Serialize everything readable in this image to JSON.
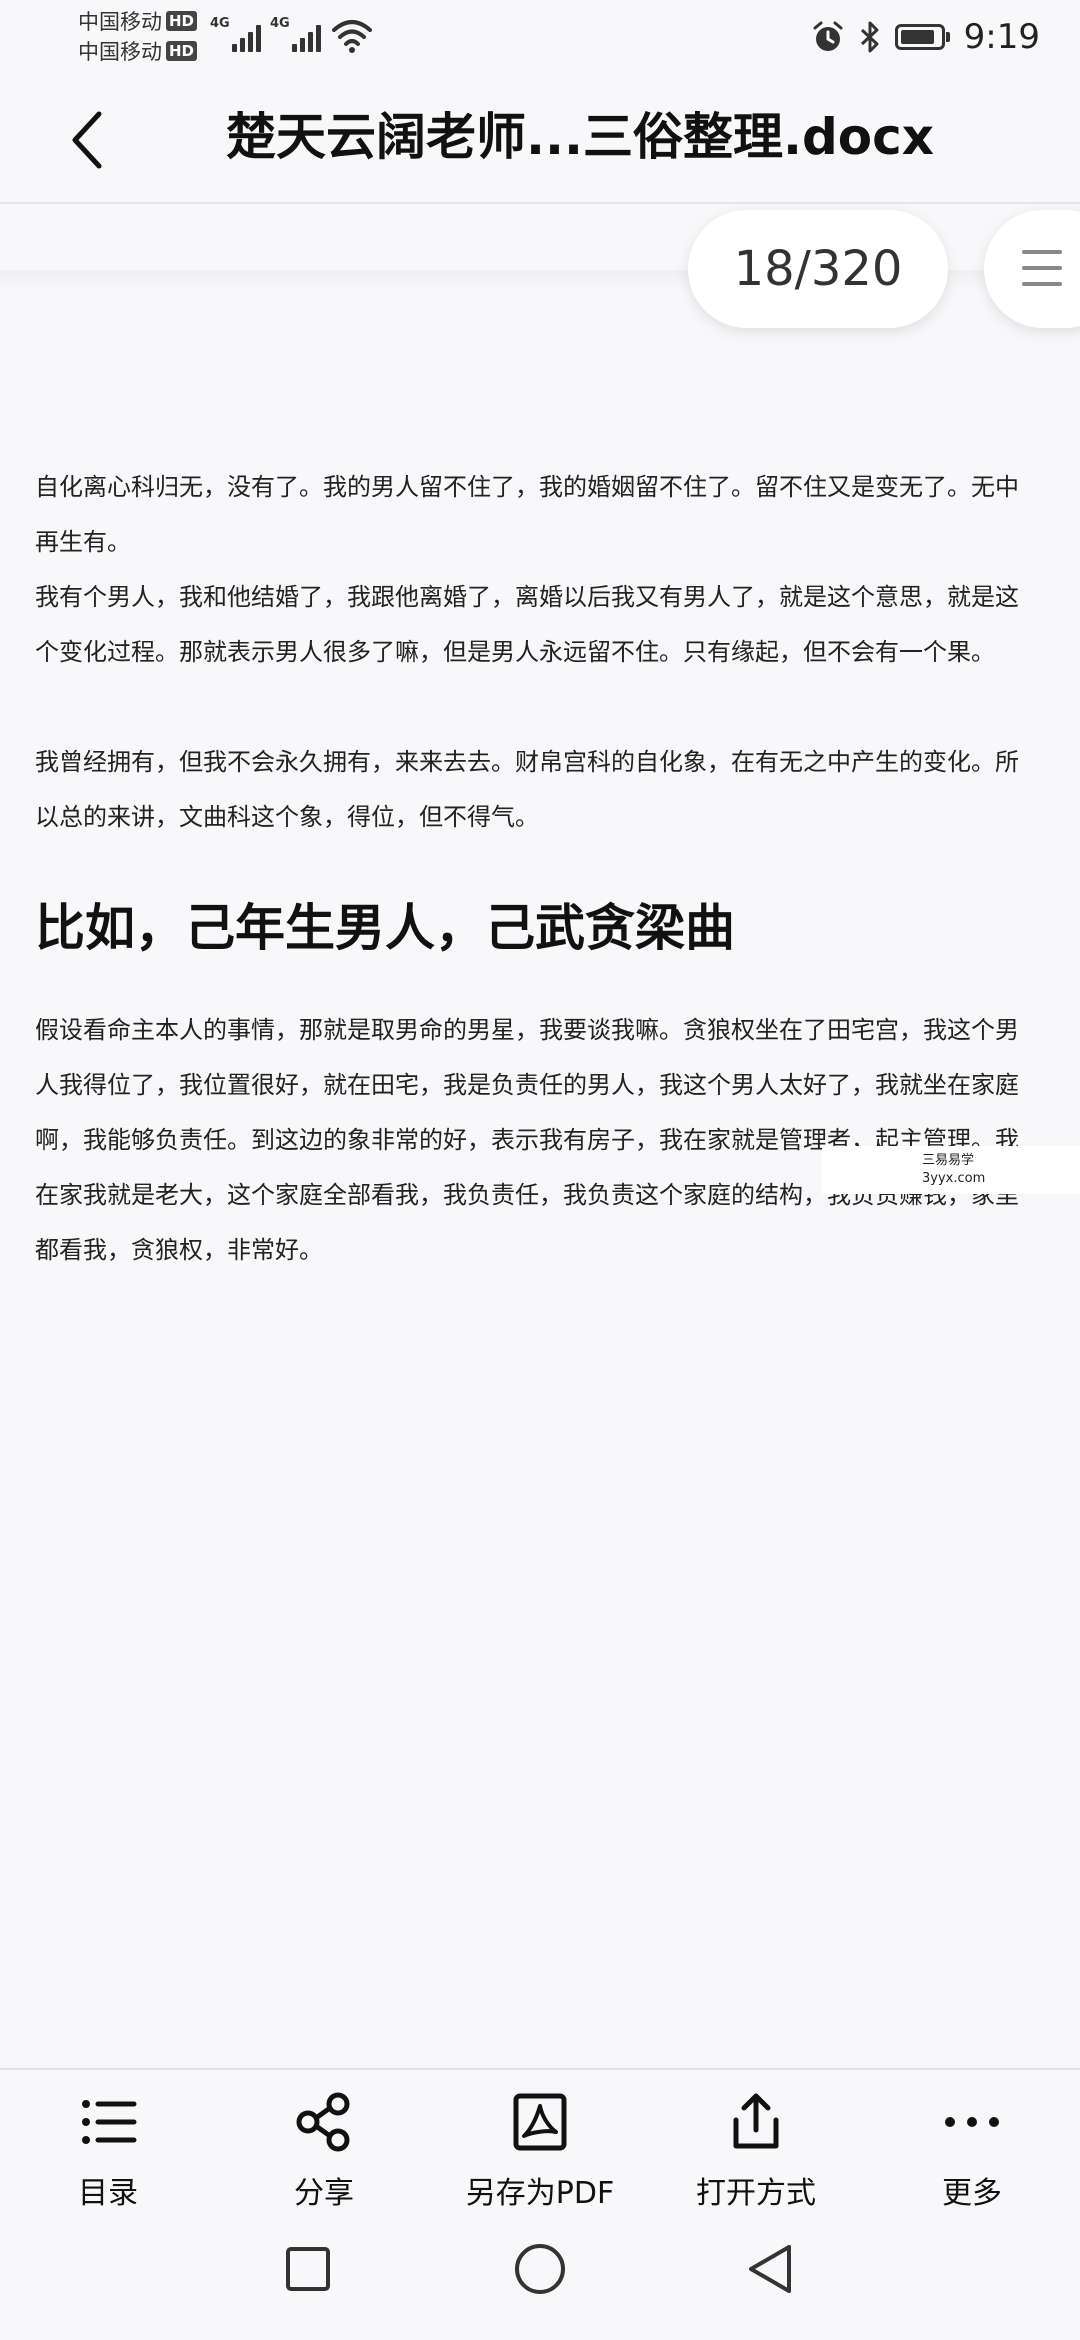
{
  "status_bar": {
    "carrier1": "中国移动",
    "carrier2": "中国移动",
    "hd_badge": "HD",
    "network1": "4G",
    "network2": "4G",
    "time": "9:19"
  },
  "header": {
    "title": "楚天云阔老师...三俗整理.docx"
  },
  "page_indicator": {
    "text": "18/320"
  },
  "document": {
    "para1": "自化离心科归无，没有了。我的男人留不住了，我的婚姻留不住了。留不住又是变无了。无中再生有。",
    "para2": "我有个男人，我和他结婚了，我跟他离婚了，离婚以后我又有男人了，就是这个意思，就是这个变化过程。那就表示男人很多了嘛，但是男人永远留不住。只有缘起，但不会有一个果。",
    "para3": "我曾经拥有，但我不会永久拥有，来来去去。财帛宫科的自化象，在有无之中产生的变化。所以总的来讲，文曲科这个象，得位，但不得气。",
    "heading": "比如，己年生男人，己武贪梁曲",
    "para4": "假设看命主本人的事情，那就是取男命的男星，我要谈我嘛。贪狼权坐在了田宅宫，我这个男人我得位了，我位置很好，就在田宅，我是负责任的男人，我这个男人太好了，我就坐在家庭啊，我能够负责任。到这边的象非常的好，表示我有房子，我在家就是管理者，起主管理。我在家我就是老大，这个家庭全部看我，我负责任，我负责这个家庭的结构，我负责赚钱，家里都看我，贪狼权，非常好。"
  },
  "watermark": {
    "line1": "三易易学",
    "line2": "3yyx.com"
  },
  "toolbar": {
    "items": [
      {
        "label": "目录",
        "icon": "list-icon"
      },
      {
        "label": "分享",
        "icon": "share-icon"
      },
      {
        "label": "另存为PDF",
        "icon": "pdf-icon"
      },
      {
        "label": "打开方式",
        "icon": "open-with-icon"
      },
      {
        "label": "更多",
        "icon": "more-icon"
      }
    ]
  },
  "nav": {
    "icons": [
      "recent-apps-icon",
      "home-icon",
      "back-nav-icon"
    ]
  }
}
